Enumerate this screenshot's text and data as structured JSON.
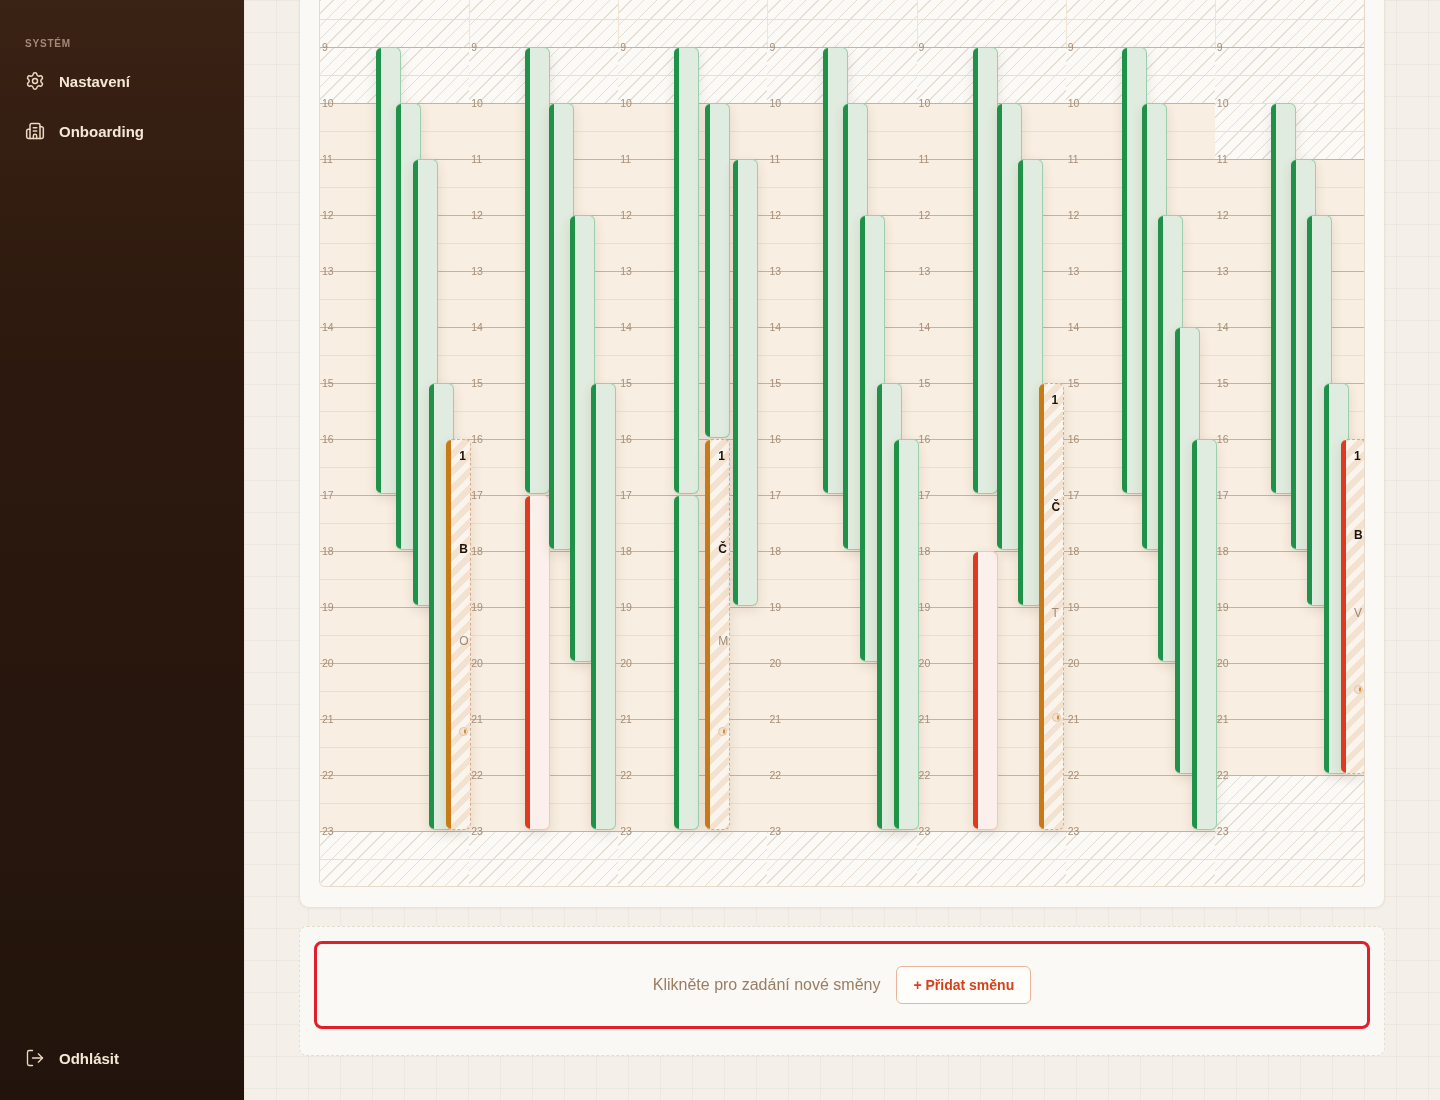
{
  "sidebar": {
    "section_label": "SYSTÉM",
    "items": [
      {
        "label": "Nastavení"
      },
      {
        "label": "Onboarding"
      }
    ],
    "logout": {
      "label": "Odhlásit"
    }
  },
  "calendar": {
    "days": [
      {
        "hours": [
          {
            "label": "9",
            "open": false,
            "cells": [
              {
                "kind": "assigned",
                "color": "#1f9148"
              }
            ]
          },
          {
            "label": "10",
            "open": true,
            "cells": [
              {
                "kind": "assigned"
              },
              {
                "kind": "assigned",
                "color": "#1f9148"
              }
            ]
          },
          {
            "label": "11",
            "open": true,
            "cells": [
              {
                "kind": "assigned"
              },
              {
                "kind": "assigned"
              },
              {
                "kind": "assigned",
                "color": "#1f9148"
              }
            ]
          },
          {
            "label": "12",
            "open": true,
            "cells": [
              {
                "kind": "assigned"
              },
              {
                "kind": "assigned"
              },
              {
                "kind": "assigned"
              }
            ]
          },
          {
            "label": "13",
            "open": true,
            "cells": [
              {
                "kind": "assigned"
              },
              {
                "kind": "assigned"
              },
              {
                "kind": "assigned"
              }
            ]
          },
          {
            "label": "14",
            "open": true,
            "cells": [
              {
                "kind": "assigned"
              },
              {
                "kind": "assigned"
              },
              {
                "kind": "assigned"
              }
            ]
          },
          {
            "label": "15",
            "open": true,
            "cells": [
              {
                "kind": "assigned"
              },
              {
                "kind": "assigned"
              },
              {
                "kind": "assigned"
              },
              {
                "kind": "assigned",
                "color": "#1f9148"
              }
            ]
          },
          {
            "label": "16",
            "open": true,
            "cells": [
              {
                "kind": "assigned"
              },
              {
                "kind": "assigned"
              },
              {
                "kind": "assigned"
              },
              {
                "kind": "assigned"
              },
              {
                "kind": "offered",
                "color": "#c77a18",
                "time": "1",
                "name": "B",
                "role": "O"
              }
            ]
          },
          {
            "label": "17",
            "open": true,
            "cells": [
              {
                "kind": "none"
              },
              {
                "kind": "assigned"
              },
              {
                "kind": "assigned"
              },
              {
                "kind": "assigned"
              },
              {
                "kind": "offered"
              }
            ]
          },
          {
            "label": "18",
            "open": true,
            "cells": [
              {
                "kind": "none"
              },
              {
                "kind": "none"
              },
              {
                "kind": "assigned"
              },
              {
                "kind": "assigned"
              },
              {
                "kind": "offered"
              }
            ]
          },
          {
            "label": "19",
            "open": true,
            "cells": [
              {
                "kind": "none"
              },
              {
                "kind": "none"
              },
              {
                "kind": "none"
              },
              {
                "kind": "assigned"
              },
              {
                "kind": "offered"
              }
            ]
          },
          {
            "label": "20",
            "open": true,
            "cells": [
              {
                "kind": "none"
              },
              {
                "kind": "none"
              },
              {
                "kind": "none"
              },
              {
                "kind": "assigned"
              },
              {
                "kind": "offered"
              }
            ]
          },
          {
            "label": "21",
            "open": true,
            "cells": [
              {
                "kind": "none"
              },
              {
                "kind": "none"
              },
              {
                "kind": "none"
              },
              {
                "kind": "assigned"
              },
              {
                "kind": "offered"
              }
            ]
          },
          {
            "label": "22",
            "open": true,
            "cells": [
              {
                "kind": "none"
              },
              {
                "kind": "none"
              },
              {
                "kind": "none"
              },
              {
                "kind": "assigned"
              },
              {
                "kind": "offered"
              }
            ]
          },
          {
            "label": "23",
            "open": false
          }
        ]
      },
      {
        "hours": [
          {
            "label": "9",
            "open": false,
            "cells": [
              {
                "kind": "assigned",
                "color": "#1f9148"
              }
            ]
          },
          {
            "label": "10",
            "open": true,
            "cells": [
              {
                "kind": "assigned"
              },
              {
                "kind": "assigned",
                "color": "#1f9148"
              }
            ]
          },
          {
            "label": "11",
            "open": true,
            "cells": [
              {
                "kind": "assigned"
              },
              {
                "kind": "assigned"
              }
            ]
          },
          {
            "label": "12",
            "open": true,
            "cells": [
              {
                "kind": "assigned"
              },
              {
                "kind": "assigned"
              },
              {
                "kind": "assigned",
                "color": "#1f9148"
              }
            ]
          },
          {
            "label": "13",
            "open": true,
            "cells": [
              {
                "kind": "assigned"
              },
              {
                "kind": "assigned"
              },
              {
                "kind": "assigned"
              }
            ]
          },
          {
            "label": "14",
            "open": true,
            "cells": [
              {
                "kind": "assigned"
              },
              {
                "kind": "assigned"
              },
              {
                "kind": "assigned"
              }
            ]
          },
          {
            "label": "15",
            "open": true,
            "cells": [
              {
                "kind": "assigned"
              },
              {
                "kind": "assigned"
              },
              {
                "kind": "assigned"
              },
              {
                "kind": "assigned",
                "color": "#1f9148"
              }
            ]
          },
          {
            "label": "16",
            "open": true,
            "cells": [
              {
                "kind": "assigned"
              },
              {
                "kind": "assigned"
              },
              {
                "kind": "assigned"
              },
              {
                "kind": "assigned"
              }
            ]
          },
          {
            "label": "17",
            "open": true,
            "cells": [
              {
                "kind": "vacant",
                "color": "#dc3b22"
              },
              {
                "kind": "assigned"
              },
              {
                "kind": "assigned"
              },
              {
                "kind": "assigned"
              }
            ]
          },
          {
            "label": "18",
            "open": true,
            "cells": [
              {
                "kind": "vacant"
              },
              {
                "kind": "none"
              },
              {
                "kind": "assigned"
              },
              {
                "kind": "assigned"
              }
            ]
          },
          {
            "label": "19",
            "open": true,
            "cells": [
              {
                "kind": "vacant"
              },
              {
                "kind": "none"
              },
              {
                "kind": "assigned"
              },
              {
                "kind": "assigned"
              }
            ]
          },
          {
            "label": "20",
            "open": true,
            "cells": [
              {
                "kind": "vacant"
              },
              {
                "kind": "none"
              },
              {
                "kind": "none"
              },
              {
                "kind": "assigned"
              }
            ]
          },
          {
            "label": "21",
            "open": true,
            "cells": [
              {
                "kind": "vacant"
              },
              {
                "kind": "none"
              },
              {
                "kind": "none"
              },
              {
                "kind": "assigned"
              }
            ]
          },
          {
            "label": "22",
            "open": true,
            "cells": [
              {
                "kind": "vacant"
              },
              {
                "kind": "none"
              },
              {
                "kind": "none"
              },
              {
                "kind": "assigned"
              }
            ]
          },
          {
            "label": "23",
            "open": false
          }
        ]
      },
      {
        "hours": [
          {
            "label": "9",
            "open": false,
            "cells": [
              {
                "kind": "assigned",
                "color": "#1f9148"
              }
            ]
          },
          {
            "label": "10",
            "open": true,
            "cells": [
              {
                "kind": "assigned"
              },
              {
                "kind": "assigned",
                "color": "#1f9148"
              }
            ]
          },
          {
            "label": "11",
            "open": true,
            "cells": [
              {
                "kind": "assigned"
              },
              {
                "kind": "assigned"
              },
              {
                "kind": "assigned",
                "color": "#1f9148"
              }
            ]
          },
          {
            "label": "12",
            "open": true,
            "cells": [
              {
                "kind": "assigned"
              },
              {
                "kind": "assigned"
              },
              {
                "kind": "assigned"
              }
            ]
          },
          {
            "label": "13",
            "open": true,
            "cells": [
              {
                "kind": "assigned"
              },
              {
                "kind": "assigned"
              },
              {
                "kind": "assigned"
              }
            ]
          },
          {
            "label": "14",
            "open": true,
            "cells": [
              {
                "kind": "assigned"
              },
              {
                "kind": "assigned"
              },
              {
                "kind": "assigned"
              }
            ]
          },
          {
            "label": "15",
            "open": true,
            "cells": [
              {
                "kind": "assigned"
              },
              {
                "kind": "assigned"
              },
              {
                "kind": "assigned"
              }
            ]
          },
          {
            "label": "16",
            "open": true,
            "cells": [
              {
                "kind": "assigned"
              },
              {
                "kind": "offered",
                "color": "#c77a18",
                "time": "1",
                "name": "Č",
                "role": "M"
              },
              {
                "kind": "assigned"
              }
            ]
          },
          {
            "label": "17",
            "open": true,
            "cells": [
              {
                "kind": "assigned",
                "color": "#1f9148"
              },
              {
                "kind": "offered"
              },
              {
                "kind": "assigned"
              }
            ]
          },
          {
            "label": "18",
            "open": true,
            "cells": [
              {
                "kind": "assigned"
              },
              {
                "kind": "offered"
              },
              {
                "kind": "assigned"
              }
            ]
          },
          {
            "label": "19",
            "open": true,
            "cells": [
              {
                "kind": "assigned"
              },
              {
                "kind": "offered"
              }
            ]
          },
          {
            "label": "20",
            "open": true,
            "cells": [
              {
                "kind": "assigned"
              },
              {
                "kind": "offered"
              }
            ]
          },
          {
            "label": "21",
            "open": true,
            "cells": [
              {
                "kind": "assigned"
              },
              {
                "kind": "offered"
              }
            ]
          },
          {
            "label": "22",
            "open": true,
            "cells": [
              {
                "kind": "assigned"
              },
              {
                "kind": "offered"
              }
            ]
          },
          {
            "label": "23",
            "open": false
          }
        ]
      },
      {
        "hours": [
          {
            "label": "9",
            "open": false,
            "cells": [
              {
                "kind": "assigned",
                "color": "#1f9148"
              }
            ]
          },
          {
            "label": "10",
            "open": true,
            "cells": [
              {
                "kind": "assigned"
              },
              {
                "kind": "assigned",
                "color": "#1f9148"
              }
            ]
          },
          {
            "label": "11",
            "open": true,
            "cells": [
              {
                "kind": "assigned"
              },
              {
                "kind": "assigned"
              }
            ]
          },
          {
            "label": "12",
            "open": true,
            "cells": [
              {
                "kind": "assigned"
              },
              {
                "kind": "assigned"
              },
              {
                "kind": "assigned",
                "color": "#1f9148"
              }
            ]
          },
          {
            "label": "13",
            "open": true,
            "cells": [
              {
                "kind": "assigned"
              },
              {
                "kind": "assigned"
              },
              {
                "kind": "assigned"
              }
            ]
          },
          {
            "label": "14",
            "open": true,
            "cells": [
              {
                "kind": "assigned"
              },
              {
                "kind": "assigned"
              },
              {
                "kind": "assigned"
              }
            ]
          },
          {
            "label": "15",
            "open": true,
            "cells": [
              {
                "kind": "assigned"
              },
              {
                "kind": "assigned"
              },
              {
                "kind": "assigned"
              },
              {
                "kind": "assigned",
                "color": "#1f9148"
              }
            ]
          },
          {
            "label": "16",
            "open": true,
            "cells": [
              {
                "kind": "assigned"
              },
              {
                "kind": "assigned"
              },
              {
                "kind": "assigned"
              },
              {
                "kind": "assigned"
              },
              {
                "kind": "assigned",
                "color": "#1f9148"
              }
            ]
          },
          {
            "label": "17",
            "open": true,
            "cells": [
              {
                "kind": "none"
              },
              {
                "kind": "assigned"
              },
              {
                "kind": "assigned"
              },
              {
                "kind": "assigned"
              },
              {
                "kind": "assigned"
              }
            ]
          },
          {
            "label": "18",
            "open": true,
            "cells": [
              {
                "kind": "none"
              },
              {
                "kind": "none"
              },
              {
                "kind": "assigned"
              },
              {
                "kind": "assigned"
              },
              {
                "kind": "assigned"
              }
            ]
          },
          {
            "label": "19",
            "open": true,
            "cells": [
              {
                "kind": "none"
              },
              {
                "kind": "none"
              },
              {
                "kind": "assigned"
              },
              {
                "kind": "assigned"
              },
              {
                "kind": "assigned"
              }
            ]
          },
          {
            "label": "20",
            "open": true,
            "cells": [
              {
                "kind": "none"
              },
              {
                "kind": "none"
              },
              {
                "kind": "none"
              },
              {
                "kind": "assigned"
              },
              {
                "kind": "assigned"
              }
            ]
          },
          {
            "label": "21",
            "open": true,
            "cells": [
              {
                "kind": "none"
              },
              {
                "kind": "none"
              },
              {
                "kind": "none"
              },
              {
                "kind": "assigned"
              },
              {
                "kind": "assigned"
              }
            ]
          },
          {
            "label": "22",
            "open": true,
            "cells": [
              {
                "kind": "none"
              },
              {
                "kind": "none"
              },
              {
                "kind": "none"
              },
              {
                "kind": "assigned"
              },
              {
                "kind": "assigned"
              }
            ]
          },
          {
            "label": "23",
            "open": false
          }
        ]
      },
      {
        "hours": [
          {
            "label": "9",
            "open": false,
            "cells": [
              {
                "kind": "assigned",
                "color": "#1f9148"
              }
            ]
          },
          {
            "label": "10",
            "open": true,
            "cells": [
              {
                "kind": "assigned"
              },
              {
                "kind": "assigned",
                "color": "#1f9148"
              }
            ]
          },
          {
            "label": "11",
            "open": true,
            "cells": [
              {
                "kind": "assigned"
              },
              {
                "kind": "assigned"
              },
              {
                "kind": "assigned",
                "color": "#1f9148"
              }
            ]
          },
          {
            "label": "12",
            "open": true,
            "cells": [
              {
                "kind": "assigned"
              },
              {
                "kind": "assigned"
              },
              {
                "kind": "assigned"
              }
            ]
          },
          {
            "label": "13",
            "open": true,
            "cells": [
              {
                "kind": "assigned"
              },
              {
                "kind": "assigned"
              },
              {
                "kind": "assigned"
              }
            ]
          },
          {
            "label": "14",
            "open": true,
            "cells": [
              {
                "kind": "assigned"
              },
              {
                "kind": "assigned"
              },
              {
                "kind": "assigned"
              }
            ]
          },
          {
            "label": "15",
            "open": true,
            "cells": [
              {
                "kind": "assigned"
              },
              {
                "kind": "assigned"
              },
              {
                "kind": "assigned"
              },
              {
                "kind": "offered",
                "color": "#c77a18",
                "time": "1",
                "name": "Č",
                "role": "T"
              }
            ]
          },
          {
            "label": "16",
            "open": true,
            "cells": [
              {
                "kind": "assigned"
              },
              {
                "kind": "assigned"
              },
              {
                "kind": "assigned"
              },
              {
                "kind": "offered"
              }
            ]
          },
          {
            "label": "17",
            "open": true,
            "cells": [
              {
                "kind": "none"
              },
              {
                "kind": "assigned"
              },
              {
                "kind": "assigned"
              },
              {
                "kind": "offered"
              }
            ]
          },
          {
            "label": "18",
            "open": true,
            "cells": [
              {
                "kind": "vacant",
                "color": "#dc3b22"
              },
              {
                "kind": "none"
              },
              {
                "kind": "assigned"
              },
              {
                "kind": "offered"
              }
            ]
          },
          {
            "label": "19",
            "open": true,
            "cells": [
              {
                "kind": "vacant"
              },
              {
                "kind": "none"
              },
              {
                "kind": "none"
              },
              {
                "kind": "offered"
              }
            ]
          },
          {
            "label": "20",
            "open": true,
            "cells": [
              {
                "kind": "vacant"
              },
              {
                "kind": "none"
              },
              {
                "kind": "none"
              },
              {
                "kind": "offered"
              }
            ]
          },
          {
            "label": "21",
            "open": true,
            "cells": [
              {
                "kind": "vacant"
              },
              {
                "kind": "none"
              },
              {
                "kind": "none"
              },
              {
                "kind": "offered"
              }
            ]
          },
          {
            "label": "22",
            "open": true,
            "cells": [
              {
                "kind": "vacant"
              },
              {
                "kind": "none"
              },
              {
                "kind": "none"
              },
              {
                "kind": "offered"
              }
            ]
          },
          {
            "label": "23",
            "open": false
          }
        ]
      },
      {
        "hours": [
          {
            "label": "9",
            "open": false,
            "cells": [
              {
                "kind": "assigned",
                "color": "#1f9148"
              }
            ]
          },
          {
            "label": "10",
            "open": true,
            "cells": [
              {
                "kind": "assigned"
              },
              {
                "kind": "assigned",
                "color": "#1f9148"
              }
            ]
          },
          {
            "label": "11",
            "open": true,
            "cells": [
              {
                "kind": "assigned"
              },
              {
                "kind": "assigned"
              }
            ]
          },
          {
            "label": "12",
            "open": true,
            "cells": [
              {
                "kind": "assigned"
              },
              {
                "kind": "assigned"
              },
              {
                "kind": "assigned",
                "color": "#1f9148"
              }
            ]
          },
          {
            "label": "13",
            "open": true,
            "cells": [
              {
                "kind": "assigned"
              },
              {
                "kind": "assigned"
              },
              {
                "kind": "assigned"
              }
            ]
          },
          {
            "label": "14",
            "open": true,
            "cells": [
              {
                "kind": "assigned"
              },
              {
                "kind": "assigned"
              },
              {
                "kind": "assigned"
              },
              {
                "kind": "assigned",
                "color": "#1f9148"
              }
            ]
          },
          {
            "label": "15",
            "open": true,
            "cells": [
              {
                "kind": "assigned"
              },
              {
                "kind": "assigned"
              },
              {
                "kind": "assigned"
              },
              {
                "kind": "assigned"
              }
            ]
          },
          {
            "label": "16",
            "open": true,
            "cells": [
              {
                "kind": "assigned"
              },
              {
                "kind": "assigned"
              },
              {
                "kind": "assigned"
              },
              {
                "kind": "assigned"
              },
              {
                "kind": "assigned",
                "color": "#1f9148"
              }
            ]
          },
          {
            "label": "17",
            "open": true,
            "cells": [
              {
                "kind": "none"
              },
              {
                "kind": "assigned"
              },
              {
                "kind": "assigned"
              },
              {
                "kind": "assigned"
              },
              {
                "kind": "assigned"
              }
            ]
          },
          {
            "label": "18",
            "open": true,
            "cells": [
              {
                "kind": "none"
              },
              {
                "kind": "none"
              },
              {
                "kind": "assigned"
              },
              {
                "kind": "assigned"
              },
              {
                "kind": "assigned"
              }
            ]
          },
          {
            "label": "19",
            "open": true,
            "cells": [
              {
                "kind": "none"
              },
              {
                "kind": "none"
              },
              {
                "kind": "assigned"
              },
              {
                "kind": "assigned"
              },
              {
                "kind": "assigned"
              }
            ]
          },
          {
            "label": "20",
            "open": true,
            "cells": [
              {
                "kind": "none"
              },
              {
                "kind": "none"
              },
              {
                "kind": "none"
              },
              {
                "kind": "assigned"
              },
              {
                "kind": "assigned"
              }
            ]
          },
          {
            "label": "21",
            "open": true,
            "cells": [
              {
                "kind": "none"
              },
              {
                "kind": "none"
              },
              {
                "kind": "none"
              },
              {
                "kind": "assigned"
              },
              {
                "kind": "assigned"
              }
            ]
          },
          {
            "label": "22",
            "open": true,
            "cells": [
              {
                "kind": "none"
              },
              {
                "kind": "none"
              },
              {
                "kind": "none"
              },
              {
                "kind": "none"
              },
              {
                "kind": "assigned"
              }
            ]
          },
          {
            "label": "23",
            "open": false
          }
        ]
      },
      {
        "hours": [
          {
            "label": "9",
            "open": false
          },
          {
            "label": "10",
            "open": false,
            "cells": [
              {
                "kind": "assigned",
                "color": "#1f9148"
              }
            ]
          },
          {
            "label": "11",
            "open": true,
            "cells": [
              {
                "kind": "assigned"
              },
              {
                "kind": "assigned",
                "color": "#1f9148"
              }
            ]
          },
          {
            "label": "12",
            "open": true,
            "cells": [
              {
                "kind": "assigned"
              },
              {
                "kind": "assigned"
              },
              {
                "kind": "assigned",
                "color": "#1f9148"
              }
            ]
          },
          {
            "label": "13",
            "open": true,
            "cells": [
              {
                "kind": "assigned"
              },
              {
                "kind": "assigned"
              },
              {
                "kind": "assigned"
              }
            ]
          },
          {
            "label": "14",
            "open": true,
            "cells": [
              {
                "kind": "assigned"
              },
              {
                "kind": "assigned"
              },
              {
                "kind": "assigned"
              }
            ]
          },
          {
            "label": "15",
            "open": true,
            "cells": [
              {
                "kind": "assigned"
              },
              {
                "kind": "assigned"
              },
              {
                "kind": "assigned"
              },
              {
                "kind": "assigned",
                "color": "#1f9148"
              }
            ]
          },
          {
            "label": "16",
            "open": true,
            "cells": [
              {
                "kind": "assigned"
              },
              {
                "kind": "assigned"
              },
              {
                "kind": "assigned"
              },
              {
                "kind": "assigned"
              },
              {
                "kind": "offered",
                "color": "#dc3b22",
                "time": "1",
                "name": "B",
                "role": "V"
              }
            ]
          },
          {
            "label": "17",
            "open": true,
            "cells": [
              {
                "kind": "none"
              },
              {
                "kind": "assigned"
              },
              {
                "kind": "assigned"
              },
              {
                "kind": "assigned"
              },
              {
                "kind": "offered"
              }
            ]
          },
          {
            "label": "18",
            "open": true,
            "cells": [
              {
                "kind": "none"
              },
              {
                "kind": "none"
              },
              {
                "kind": "assigned"
              },
              {
                "kind": "assigned"
              },
              {
                "kind": "offered"
              }
            ]
          },
          {
            "label": "19",
            "open": true,
            "cells": [
              {
                "kind": "none"
              },
              {
                "kind": "none"
              },
              {
                "kind": "none"
              },
              {
                "kind": "assigned"
              },
              {
                "kind": "offered"
              }
            ]
          },
          {
            "label": "20",
            "open": true,
            "cells": [
              {
                "kind": "none"
              },
              {
                "kind": "none"
              },
              {
                "kind": "none"
              },
              {
                "kind": "assigned"
              },
              {
                "kind": "offered"
              }
            ]
          },
          {
            "label": "21",
            "open": true,
            "cells": [
              {
                "kind": "none"
              },
              {
                "kind": "none"
              },
              {
                "kind": "none"
              },
              {
                "kind": "assigned"
              },
              {
                "kind": "offered"
              }
            ]
          },
          {
            "label": "22",
            "open": false
          },
          {
            "label": "23",
            "open": false
          }
        ]
      }
    ]
  },
  "add_shift": {
    "highlighted": true,
    "hint": "Klikněte pro zadání nové směny",
    "button": "+ Přidat směnu"
  }
}
